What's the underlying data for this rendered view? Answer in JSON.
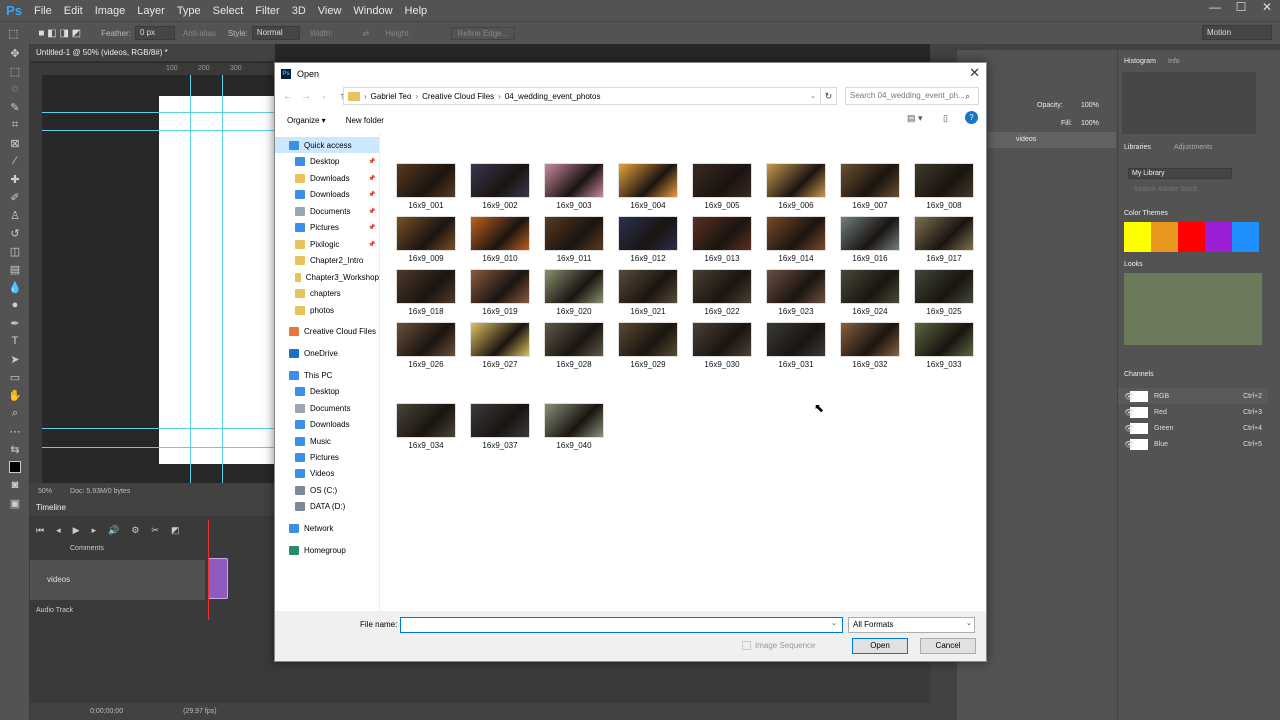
{
  "app": {
    "logo": "Ps",
    "menu": [
      "File",
      "Edit",
      "Image",
      "Layer",
      "Type",
      "Select",
      "Filter",
      "3D",
      "View",
      "Window",
      "Help"
    ],
    "window_controls": [
      "—",
      "☐",
      "✕"
    ]
  },
  "options_bar": {
    "feather_label": "Feather:",
    "feather_value": "0 px",
    "anti_alias": "Anti-alias",
    "style_label": "Style:",
    "style_value": "Normal",
    "width_label": "Width:",
    "height_label": "Height:",
    "refine_edge": "Refine Edge...",
    "workspace": "Motion"
  },
  "document": {
    "tab_title": "Untitled-1 @ 50% (videos, RGB/8#) *",
    "ruler_ticks": [
      "100",
      "200",
      "300"
    ],
    "zoom": "50%",
    "doc_info": "Doc: 5.93M/0 bytes"
  },
  "timeline": {
    "header": "Timeline",
    "comments": "Comments",
    "track": "videos",
    "audio": "Audio Track",
    "timecode": "0;00;00;00",
    "fps": "(29.97 fps)"
  },
  "panels": {
    "histogram": "Histogram",
    "info": "Info",
    "libraries": "Libraries",
    "adjustments": "Adjustments",
    "library_select": "My Library",
    "search_stock": "Search Adobe Stock",
    "color_themes": "Color Themes",
    "looks": "Looks",
    "channels": "Channels",
    "opacity_label": "Opacity:",
    "opacity_value": "100%",
    "fill_label": "Fill:",
    "fill_value": "100%",
    "layer_name": "videos",
    "theme_colors": [
      "#ffff00",
      "#e8961e",
      "#ff0000",
      "#9b1fd4",
      "#1e90ff"
    ],
    "channel_rows": [
      {
        "name": "RGB",
        "shortcut": "Ctrl+2"
      },
      {
        "name": "Red",
        "shortcut": "Ctrl+3"
      },
      {
        "name": "Green",
        "shortcut": "Ctrl+4"
      },
      {
        "name": "Blue",
        "shortcut": "Ctrl+5"
      }
    ]
  },
  "dialog": {
    "title": "Open",
    "breadcrumb": [
      "Gabriel Teo",
      "Creative Cloud Files",
      "04_wedding_event_photos"
    ],
    "search_placeholder": "Search 04_wedding_event_ph...",
    "organize": "Organize ▾",
    "new_folder": "New folder",
    "nav": [
      {
        "label": "Quick access",
        "icon": "star",
        "color": "#3c8ee6"
      },
      {
        "label": "Desktop",
        "icon": "folder",
        "color": "#3c8ee6"
      },
      {
        "label": "Downloads",
        "icon": "folder",
        "color": "#e8c35a"
      },
      {
        "label": "Downloads",
        "icon": "download",
        "color": "#3c8ee6"
      },
      {
        "label": "Documents",
        "icon": "folder",
        "color": "#9aa7b3"
      },
      {
        "label": "Pictures",
        "icon": "folder",
        "color": "#3c8ee6"
      },
      {
        "label": "Pixilogic",
        "icon": "folder",
        "color": "#e8c35a"
      },
      {
        "label": "Chapter2_Intro",
        "icon": "folder",
        "color": "#e8c35a"
      },
      {
        "label": "Chapter3_Workshop",
        "icon": "folder",
        "color": "#e8c35a"
      },
      {
        "label": "chapters",
        "icon": "folder",
        "color": "#e8c35a"
      },
      {
        "label": "photos",
        "icon": "folder",
        "color": "#e8c35a"
      },
      {
        "label": "Creative Cloud Files",
        "icon": "folder",
        "color": "#e8763a"
      },
      {
        "label": "OneDrive",
        "icon": "cloud",
        "color": "#1a6fc7"
      },
      {
        "label": "This PC",
        "icon": "pc",
        "color": "#3c8ee6"
      },
      {
        "label": "Desktop",
        "icon": "folder",
        "color": "#3c8ee6"
      },
      {
        "label": "Documents",
        "icon": "folder",
        "color": "#9aa7b3"
      },
      {
        "label": "Downloads",
        "icon": "download",
        "color": "#3c8ee6"
      },
      {
        "label": "Music",
        "icon": "music",
        "color": "#3c8ee6"
      },
      {
        "label": "Pictures",
        "icon": "folder",
        "color": "#3c8ee6"
      },
      {
        "label": "Videos",
        "icon": "folder",
        "color": "#3c8ee6"
      },
      {
        "label": "OS (C:)",
        "icon": "drive",
        "color": "#7a8a9a"
      },
      {
        "label": "DATA (D:)",
        "icon": "drive",
        "color": "#7a8a9a"
      },
      {
        "label": "Network",
        "icon": "network",
        "color": "#3c8ee6"
      },
      {
        "label": "Homegroup",
        "icon": "homegroup",
        "color": "#2a8a6a"
      }
    ],
    "files": [
      {
        "name": "16x9_001",
        "color": "#5b3a20"
      },
      {
        "name": "16x9_002",
        "color": "#3a3550"
      },
      {
        "name": "16x9_003",
        "color": "#c88aa0"
      },
      {
        "name": "16x9_004",
        "color": "#e8a040"
      },
      {
        "name": "16x9_005",
        "color": "#3a2a22"
      },
      {
        "name": "16x9_006",
        "color": "#c89a50"
      },
      {
        "name": "16x9_007",
        "color": "#6a5030"
      },
      {
        "name": "16x9_008",
        "color": "#403a28"
      },
      {
        "name": "16x9_009",
        "color": "#7a5028"
      },
      {
        "name": "16x9_010",
        "color": "#c06020"
      },
      {
        "name": "16x9_011",
        "color": "#5a3a20"
      },
      {
        "name": "16x9_012",
        "color": "#2a3050"
      },
      {
        "name": "16x9_013",
        "color": "#5a3020"
      },
      {
        "name": "16x9_014",
        "color": "#7a4a28"
      },
      {
        "name": "16x9_016",
        "color": "#708080"
      },
      {
        "name": "16x9_017",
        "color": "#807050"
      },
      {
        "name": "16x9_018",
        "color": "#503a28"
      },
      {
        "name": "16x9_019",
        "color": "#8a5a40"
      },
      {
        "name": "16x9_020",
        "color": "#8a9070"
      },
      {
        "name": "16x9_021",
        "color": "#5a4a38"
      },
      {
        "name": "16x9_022",
        "color": "#4a4030"
      },
      {
        "name": "16x9_023",
        "color": "#6a5040"
      },
      {
        "name": "16x9_024",
        "color": "#4a4a38"
      },
      {
        "name": "16x9_025",
        "color": "#404838"
      },
      {
        "name": "16x9_026",
        "color": "#6a5038"
      },
      {
        "name": "16x9_027",
        "color": "#e0c060"
      },
      {
        "name": "16x9_028",
        "color": "#605848"
      },
      {
        "name": "16x9_029",
        "color": "#5a4a30"
      },
      {
        "name": "16x9_030",
        "color": "#4a4038"
      },
      {
        "name": "16x9_031",
        "color": "#3a3a38"
      },
      {
        "name": "16x9_032",
        "color": "#8a6040"
      },
      {
        "name": "16x9_033",
        "color": "#5a6840"
      },
      {
        "name": "16x9_034",
        "color": "#4a4538"
      },
      {
        "name": "16x9_037",
        "color": "#3a3a3a"
      },
      {
        "name": "16x9_040",
        "color": "#8a9078"
      }
    ],
    "file_name_label": "File name:",
    "file_name_value": "",
    "format": "All Formats",
    "image_sequence": "Image Sequence",
    "open_btn": "Open",
    "cancel_btn": "Cancel"
  }
}
